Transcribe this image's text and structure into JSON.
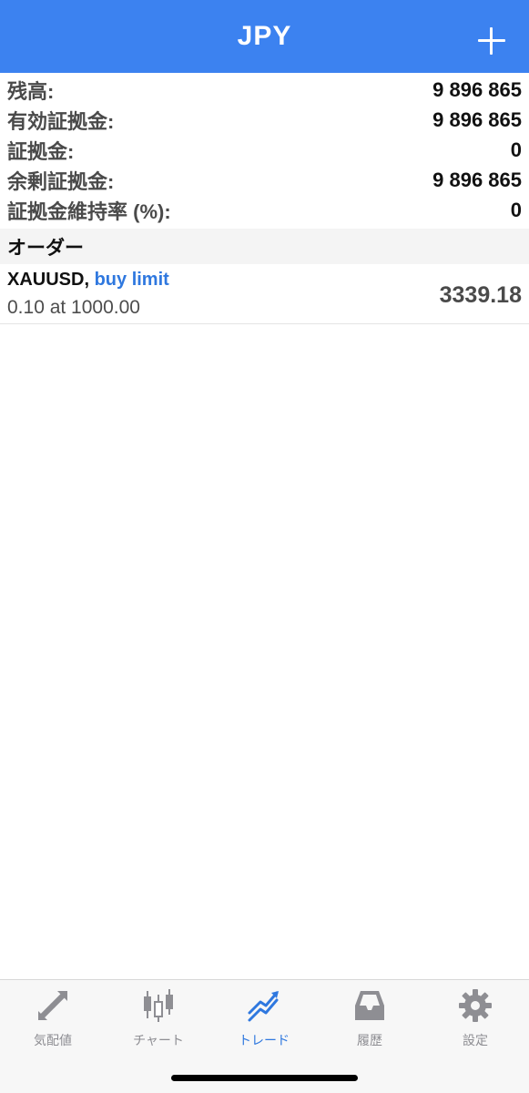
{
  "header": {
    "title": "JPY"
  },
  "summary": {
    "balance": {
      "label": "残高:",
      "value": "9 896 865"
    },
    "equity": {
      "label": "有効証拠金:",
      "value": "9 896 865"
    },
    "margin": {
      "label": "証拠金:",
      "value": "0"
    },
    "free_margin": {
      "label": "余剰証拠金:",
      "value": "9 896 865"
    },
    "margin_level": {
      "label": "証拠金維持率 (%):",
      "value": "0"
    }
  },
  "orders_section": {
    "title": "オーダー"
  },
  "orders": [
    {
      "symbol": "XAUUSD,",
      "type": "buy limit",
      "volume_line": "0.10 at 1000.00",
      "price": "3339.18"
    }
  ],
  "tabs": [
    {
      "label": "気配値",
      "icon": "quotes-arrows-icon"
    },
    {
      "label": "チャート",
      "icon": "candlestick-chart-icon"
    },
    {
      "label": "トレード",
      "icon": "trade-trend-icon",
      "active": true
    },
    {
      "label": "履歴",
      "icon": "history-tray-icon"
    },
    {
      "label": "設定",
      "icon": "settings-gear-icon"
    }
  ],
  "colors": {
    "header_bg": "#3c82f0",
    "accent": "#2f78df",
    "inactive_tab": "#8e8e93"
  }
}
